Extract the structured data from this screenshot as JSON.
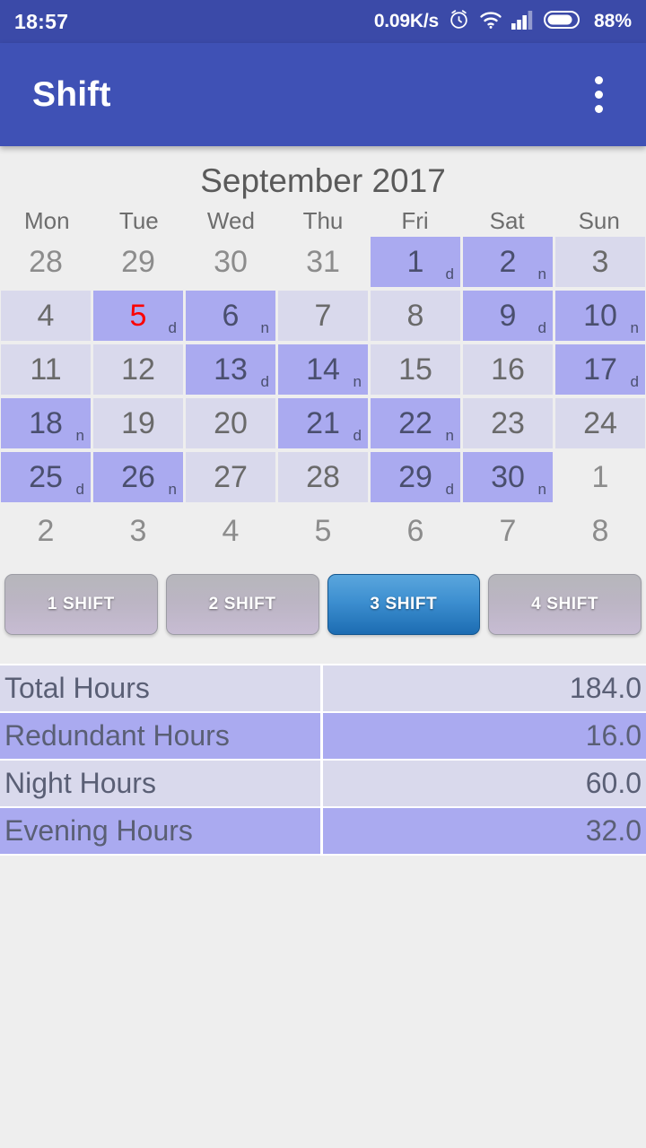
{
  "status_bar": {
    "time": "18:57",
    "network_speed": "0.09K/s",
    "battery_percent": "88%",
    "icons": [
      "alarm-icon",
      "wifi-icon",
      "signal-icon",
      "battery-icon"
    ]
  },
  "app_bar": {
    "title": "Shift",
    "overflow_label": "More options"
  },
  "calendar": {
    "month_title": "September 2017",
    "weekdays": [
      "Mon",
      "Tue",
      "Wed",
      "Thu",
      "Fri",
      "Sat",
      "Sun"
    ],
    "days": [
      {
        "num": "28",
        "state": "blank",
        "marker": "",
        "today": false
      },
      {
        "num": "29",
        "state": "blank",
        "marker": "",
        "today": false
      },
      {
        "num": "30",
        "state": "blank",
        "marker": "",
        "today": false
      },
      {
        "num": "31",
        "state": "blank",
        "marker": "",
        "today": false
      },
      {
        "num": "1",
        "state": "shift",
        "marker": "d",
        "today": false
      },
      {
        "num": "2",
        "state": "shift",
        "marker": "n",
        "today": false
      },
      {
        "num": "3",
        "state": "off",
        "marker": "",
        "today": false
      },
      {
        "num": "4",
        "state": "off",
        "marker": "",
        "today": false
      },
      {
        "num": "5",
        "state": "shift",
        "marker": "d",
        "today": true
      },
      {
        "num": "6",
        "state": "shift",
        "marker": "n",
        "today": false
      },
      {
        "num": "7",
        "state": "off",
        "marker": "",
        "today": false
      },
      {
        "num": "8",
        "state": "off",
        "marker": "",
        "today": false
      },
      {
        "num": "9",
        "state": "shift",
        "marker": "d",
        "today": false
      },
      {
        "num": "10",
        "state": "shift",
        "marker": "n",
        "today": false
      },
      {
        "num": "11",
        "state": "off",
        "marker": "",
        "today": false
      },
      {
        "num": "12",
        "state": "off",
        "marker": "",
        "today": false
      },
      {
        "num": "13",
        "state": "shift",
        "marker": "d",
        "today": false
      },
      {
        "num": "14",
        "state": "shift",
        "marker": "n",
        "today": false
      },
      {
        "num": "15",
        "state": "off",
        "marker": "",
        "today": false
      },
      {
        "num": "16",
        "state": "off",
        "marker": "",
        "today": false
      },
      {
        "num": "17",
        "state": "shift",
        "marker": "d",
        "today": false
      },
      {
        "num": "18",
        "state": "shift",
        "marker": "n",
        "today": false
      },
      {
        "num": "19",
        "state": "off",
        "marker": "",
        "today": false
      },
      {
        "num": "20",
        "state": "off",
        "marker": "",
        "today": false
      },
      {
        "num": "21",
        "state": "shift",
        "marker": "d",
        "today": false
      },
      {
        "num": "22",
        "state": "shift",
        "marker": "n",
        "today": false
      },
      {
        "num": "23",
        "state": "off",
        "marker": "",
        "today": false
      },
      {
        "num": "24",
        "state": "off",
        "marker": "",
        "today": false
      },
      {
        "num": "25",
        "state": "shift",
        "marker": "d",
        "today": false
      },
      {
        "num": "26",
        "state": "shift",
        "marker": "n",
        "today": false
      },
      {
        "num": "27",
        "state": "off",
        "marker": "",
        "today": false
      },
      {
        "num": "28",
        "state": "off",
        "marker": "",
        "today": false
      },
      {
        "num": "29",
        "state": "shift",
        "marker": "d",
        "today": false
      },
      {
        "num": "30",
        "state": "shift",
        "marker": "n",
        "today": false
      },
      {
        "num": "1",
        "state": "blank",
        "marker": "",
        "today": false
      },
      {
        "num": "2",
        "state": "blank",
        "marker": "",
        "today": false
      },
      {
        "num": "3",
        "state": "blank",
        "marker": "",
        "today": false
      },
      {
        "num": "4",
        "state": "blank",
        "marker": "",
        "today": false
      },
      {
        "num": "5",
        "state": "blank",
        "marker": "",
        "today": false
      },
      {
        "num": "6",
        "state": "blank",
        "marker": "",
        "today": false
      },
      {
        "num": "7",
        "state": "blank",
        "marker": "",
        "today": false
      },
      {
        "num": "8",
        "state": "blank",
        "marker": "",
        "today": false
      }
    ]
  },
  "shift_buttons": [
    {
      "label": "1 SHIFT",
      "selected": false
    },
    {
      "label": "2 SHIFT",
      "selected": false
    },
    {
      "label": "3 SHIFT",
      "selected": true
    },
    {
      "label": "4 SHIFT",
      "selected": false
    }
  ],
  "hours_table": {
    "rows": [
      {
        "label": "Total Hours",
        "value": "184.0",
        "tone": "light"
      },
      {
        "label": "Redundant Hours",
        "value": "16.0",
        "tone": "dark"
      },
      {
        "label": "Night Hours",
        "value": "60.0",
        "tone": "light"
      },
      {
        "label": "Evening Hours",
        "value": "32.0",
        "tone": "dark"
      }
    ]
  },
  "colors": {
    "status_bar": "#3b4aa8",
    "app_bar": "#3f51b5",
    "page_bg": "#eeeeee",
    "cell_shift": "#aaaaf0",
    "cell_off": "#d9d9ec",
    "today_text": "#fb0000",
    "button_active": "#3d8fd0"
  }
}
